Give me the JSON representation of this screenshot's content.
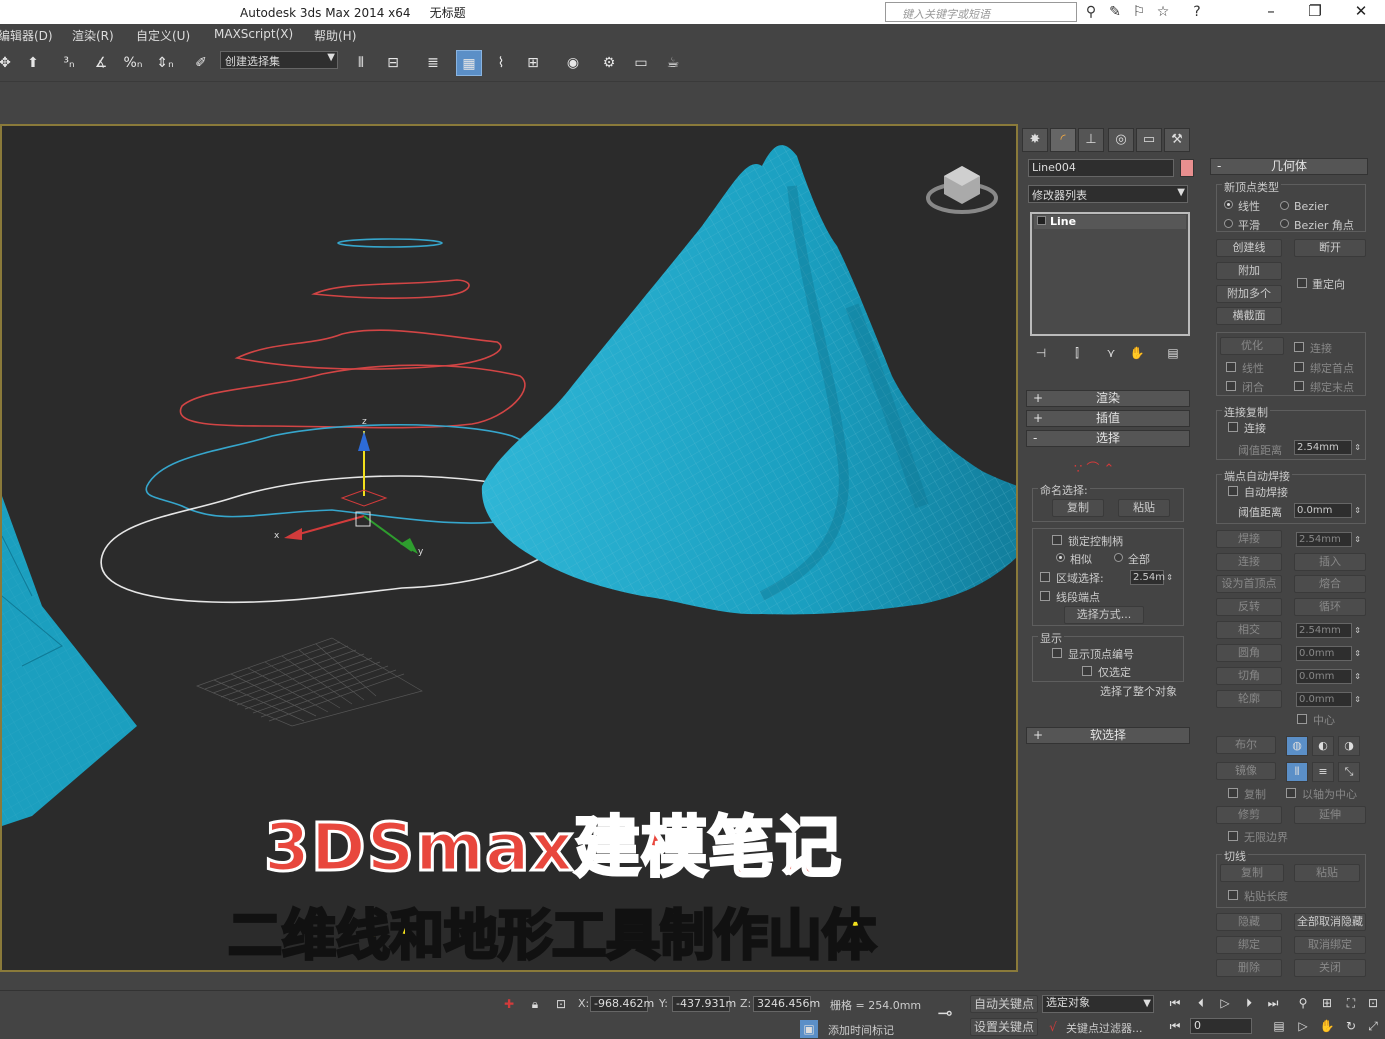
{
  "app": {
    "title": "Autodesk 3ds Max  2014 x64",
    "doc_title": "无标题",
    "search_placeholder": "键入关键字或短语"
  },
  "menu": [
    "编辑器(D)",
    "渲染(R)",
    "自定义(U)",
    "MAXScript(X)",
    "帮助(H)"
  ],
  "toolbar": {
    "selection_set_placeholder": "创建选择集"
  },
  "overlay": {
    "title": "3DSmax建模笔记",
    "subtitle": "二维线和地形工具制作山体"
  },
  "viewport": {
    "gizmo_axes": [
      "z",
      "x",
      "y"
    ]
  },
  "command_panel": {
    "object_name": "Line004",
    "object_color": "#e88f8f",
    "modifier_list": "修改器列表",
    "stack_item": "Line",
    "rollouts": {
      "render": "渲染",
      "interpolation": "插值",
      "selection": "选择",
      "soft_selection": "软选择",
      "geometry": "几何体"
    },
    "selection": {
      "named_selection": "命名选择:",
      "copy": "复制",
      "paste": "粘贴",
      "lock_handles": "锁定控制柄",
      "alike": "相似",
      "all": "全部",
      "area_selection": "区域选择:",
      "area_value": "2.54m",
      "segment_end": "线段端点",
      "select_by": "选择方式...",
      "display": "显示",
      "show_vertex_numbers": "显示顶点编号",
      "selected_only": "仅选定",
      "status": "选择了整个对象"
    },
    "geometry": {
      "new_vertex_type": "新顶点类型",
      "linear": "线性",
      "bezier": "Bezier",
      "smooth": "平滑",
      "bezier_corner": "Bezier 角点",
      "create_line": "创建线",
      "break": "断开",
      "attach": "附加",
      "reorient": "重定向",
      "attach_multiple": "附加多个",
      "cross_section": "横截面",
      "refine": "优化",
      "connect": "连接",
      "linear2": "线性",
      "bind_first": "绑定首点",
      "closed": "闭合",
      "bind_last": "绑定末点",
      "connect_copy": "连接复制",
      "connect2": "连接",
      "threshold": "阈值距离",
      "threshold_value": "2.54mm",
      "end_auto_weld": "端点自动焊接",
      "auto_weld": "自动焊接",
      "threshold2": "阈值距离",
      "threshold2_value": "0.0mm",
      "weld": "焊接",
      "weld_value": "2.54mm",
      "connect3": "连接",
      "insert": "插入",
      "make_first": "设为首顶点",
      "fuse": "熔合",
      "reverse": "反转",
      "cycle": "循环",
      "cross_insert": "相交",
      "cross_value": "2.54mm",
      "fillet": "圆角",
      "fillet_value": "0.0mm",
      "chamfer": "切角",
      "chamfer_value": "0.0mm",
      "outline": "轮廓",
      "outline_value": "0.0mm",
      "center": "中心",
      "boolean": "布尔",
      "mirror": "镜像",
      "copy": "复制",
      "about_pivot": "以轴为中心",
      "trim": "修剪",
      "extend": "延伸",
      "infinite_bounds": "无限边界",
      "tangent": "切线",
      "tangent_copy": "复制",
      "tangent_paste": "粘贴",
      "paste_length": "粘贴长度",
      "hide": "隐藏",
      "unhide_all": "全部取消隐藏",
      "bind": "绑定",
      "unbind": "取消绑定",
      "delete": "删除",
      "close": "关闭"
    }
  },
  "status_bar": {
    "x_label": "X:",
    "x_value": "-968.462m",
    "y_label": "Y:",
    "y_value": "-437.931m",
    "z_label": "Z:",
    "z_value": "3246.456m",
    "grid": "栅格 = 254.0mm",
    "auto_key": "自动关键点",
    "selected_object": "选定对象",
    "set_key": "设置关键点",
    "key_filters": "关键点过滤器...",
    "add_time_tag": "添加时间标记",
    "frame": "0"
  },
  "colors": {
    "mountain": "#1fa3c4",
    "mountain_wire": "#7fd2e6",
    "spline_blue": "#36a6cc",
    "spline_red": "#d24545",
    "spline_white": "#e6e6e6",
    "viewport_border": "#8a7a3a",
    "active_tool": "#5b8fc7"
  }
}
